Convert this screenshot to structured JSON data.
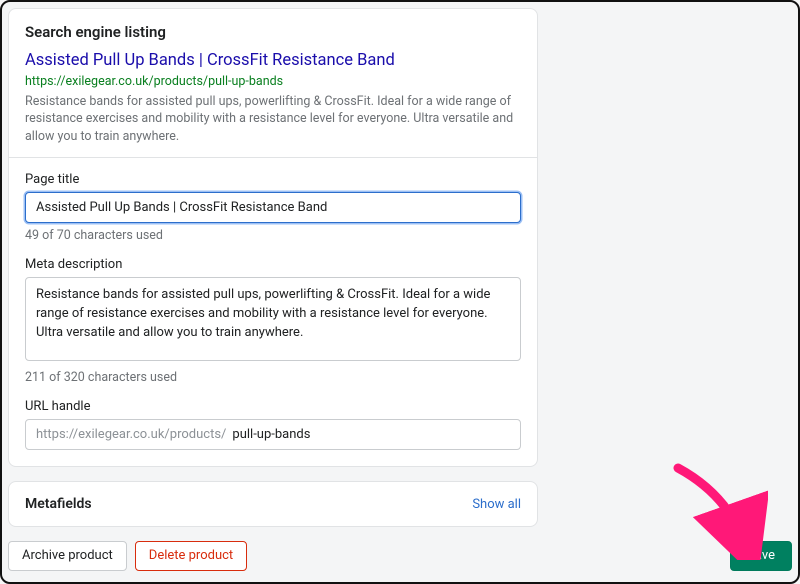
{
  "seo": {
    "section_title": "Search engine listing",
    "preview": {
      "title": "Assisted Pull Up Bands | CrossFit Resistance Band",
      "url": "https://exilegear.co.uk/products/pull-up-bands",
      "description": "Resistance bands for assisted pull ups, powerlifting & CrossFit. Ideal for a wide range of resistance exercises and mobility with a resistance level for everyone. Ultra versatile and allow you to train anywhere."
    },
    "page_title": {
      "label": "Page title",
      "value": "Assisted Pull Up Bands | CrossFit Resistance Band",
      "helper": "49 of 70 characters used"
    },
    "meta_description": {
      "label": "Meta description",
      "value": "Resistance bands for assisted pull ups, powerlifting & CrossFit. Ideal for a wide range of resistance exercises and mobility with a resistance level for everyone. Ultra versatile and allow you to train anywhere.",
      "helper": "211 of 320 characters used"
    },
    "url_handle": {
      "label": "URL handle",
      "prefix": "https://exilegear.co.uk/products/",
      "value": "pull-up-bands"
    }
  },
  "metafields": {
    "title": "Metafields",
    "show_all": "Show all"
  },
  "footer": {
    "archive": "Archive product",
    "delete": "Delete product",
    "save": "Save"
  }
}
